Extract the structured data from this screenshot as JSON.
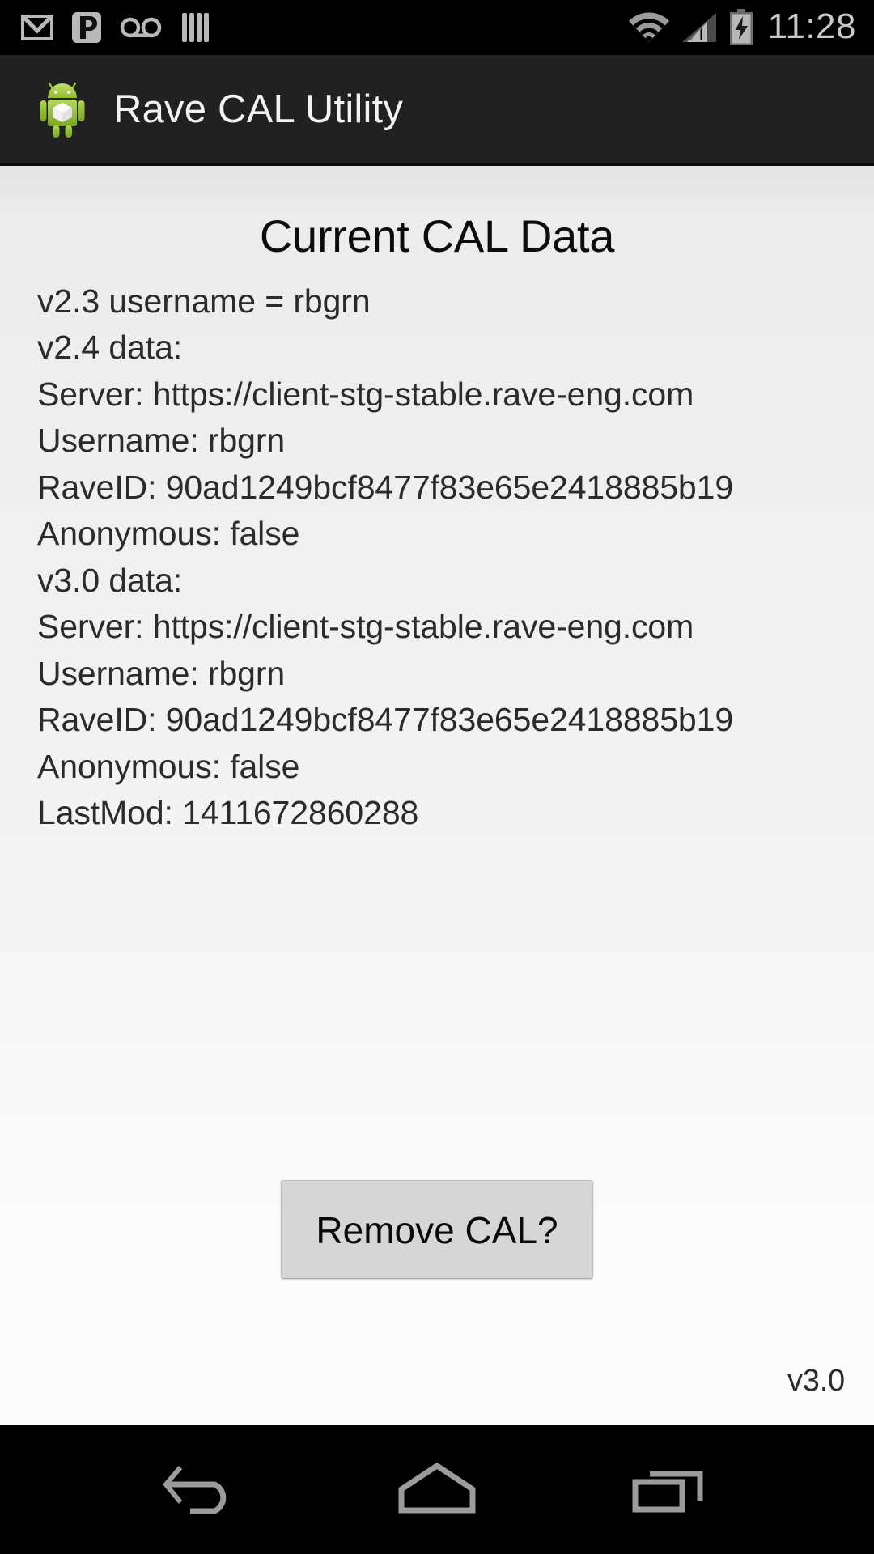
{
  "status_bar": {
    "icons": [
      {
        "name": "gmail-icon",
        "label": "Gmail"
      },
      {
        "name": "pandora-icon",
        "label": "Pandora"
      },
      {
        "name": "voicemail-icon",
        "label": "Voicemail"
      },
      {
        "name": "notification-bars-icon",
        "label": "Notification"
      }
    ],
    "wifi_icon": "wifi-icon",
    "signal_icon": "cell-signal-icon",
    "battery_icon": "battery-charging-icon",
    "time": "11:28"
  },
  "action_bar": {
    "app_icon": "android-robot-icon",
    "title": "Rave CAL Utility"
  },
  "main": {
    "page_title": "Current CAL Data",
    "lines": [
      "v2.3 username = rbgrn",
      "v2.4 data:",
      "Server: https://client-stg-stable.rave-eng.com",
      "Username: rbgrn",
      "RaveID: 90ad1249bcf8477f83e65e2418885b19",
      "Anonymous: false",
      "v3.0 data:",
      "Server: https://client-stg-stable.rave-eng.com",
      "Username: rbgrn",
      "RaveID: 90ad1249bcf8477f83e65e2418885b19",
      "Anonymous: false",
      "LastMod: 1411672860288"
    ],
    "remove_button_label": "Remove CAL?",
    "version_label": "v3.0"
  },
  "nav_bar": {
    "back": "back-icon",
    "home": "home-icon",
    "recents": "recents-icon"
  },
  "colors": {
    "status_bar_bg": "#000000",
    "action_bar_bg": "#212121",
    "content_bg_top": "#e4e4e4",
    "content_bg_bottom": "#fcfcfc",
    "text": "#2b2b2b",
    "title": "#0c0c0c",
    "button_bg": "#d6d6d6",
    "android_green": "#a4c639",
    "icon_gray": "#b2b2b2"
  }
}
